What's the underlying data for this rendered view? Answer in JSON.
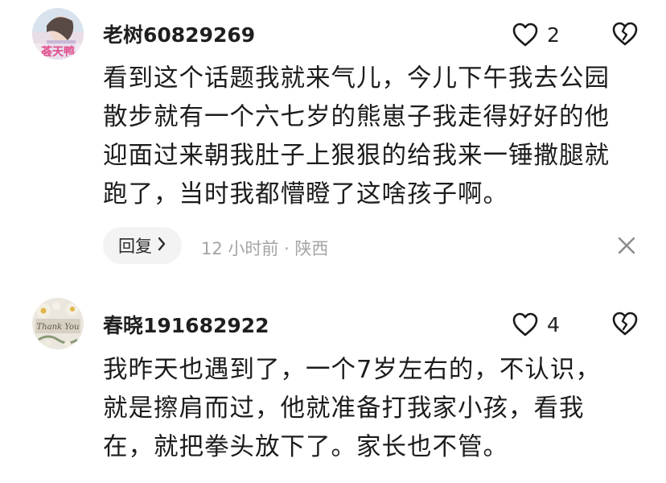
{
  "comments": [
    {
      "avatar": {
        "overlay_text": "荟天鸭"
      },
      "username": "老树60829269",
      "likes": "2",
      "text": "看到这个话题我就来气儿，今儿下午我去公园\n散步就有一个六七岁的熊崽子我走得好好的他\n迎面过来朝我肚子上狠狠的给我来一锤撒腿就\n跑了，当时我都懵瞪了这啥孩子啊。",
      "reply_label": "回复",
      "meta": "12 小时前 · 陕西"
    },
    {
      "avatar": {
        "overlay_text": "Thank You"
      },
      "username": "春晓191682922",
      "likes": "4",
      "text": "我昨天也遇到了，一个7岁左右的，不认识，\n就是擦肩而过，他就准备打我家小孩，看我\n在，就把拳头放下了。家长也不管。"
    }
  ],
  "icons": {
    "like": "heart-outline-icon",
    "dislike": "broken-heart-icon",
    "close": "close-icon",
    "reply_chevron": "chevron-right-icon"
  },
  "colors": {
    "text": "#1c1c1c",
    "meta": "#a5a5a5",
    "pill_bg": "#f3f3f3"
  }
}
